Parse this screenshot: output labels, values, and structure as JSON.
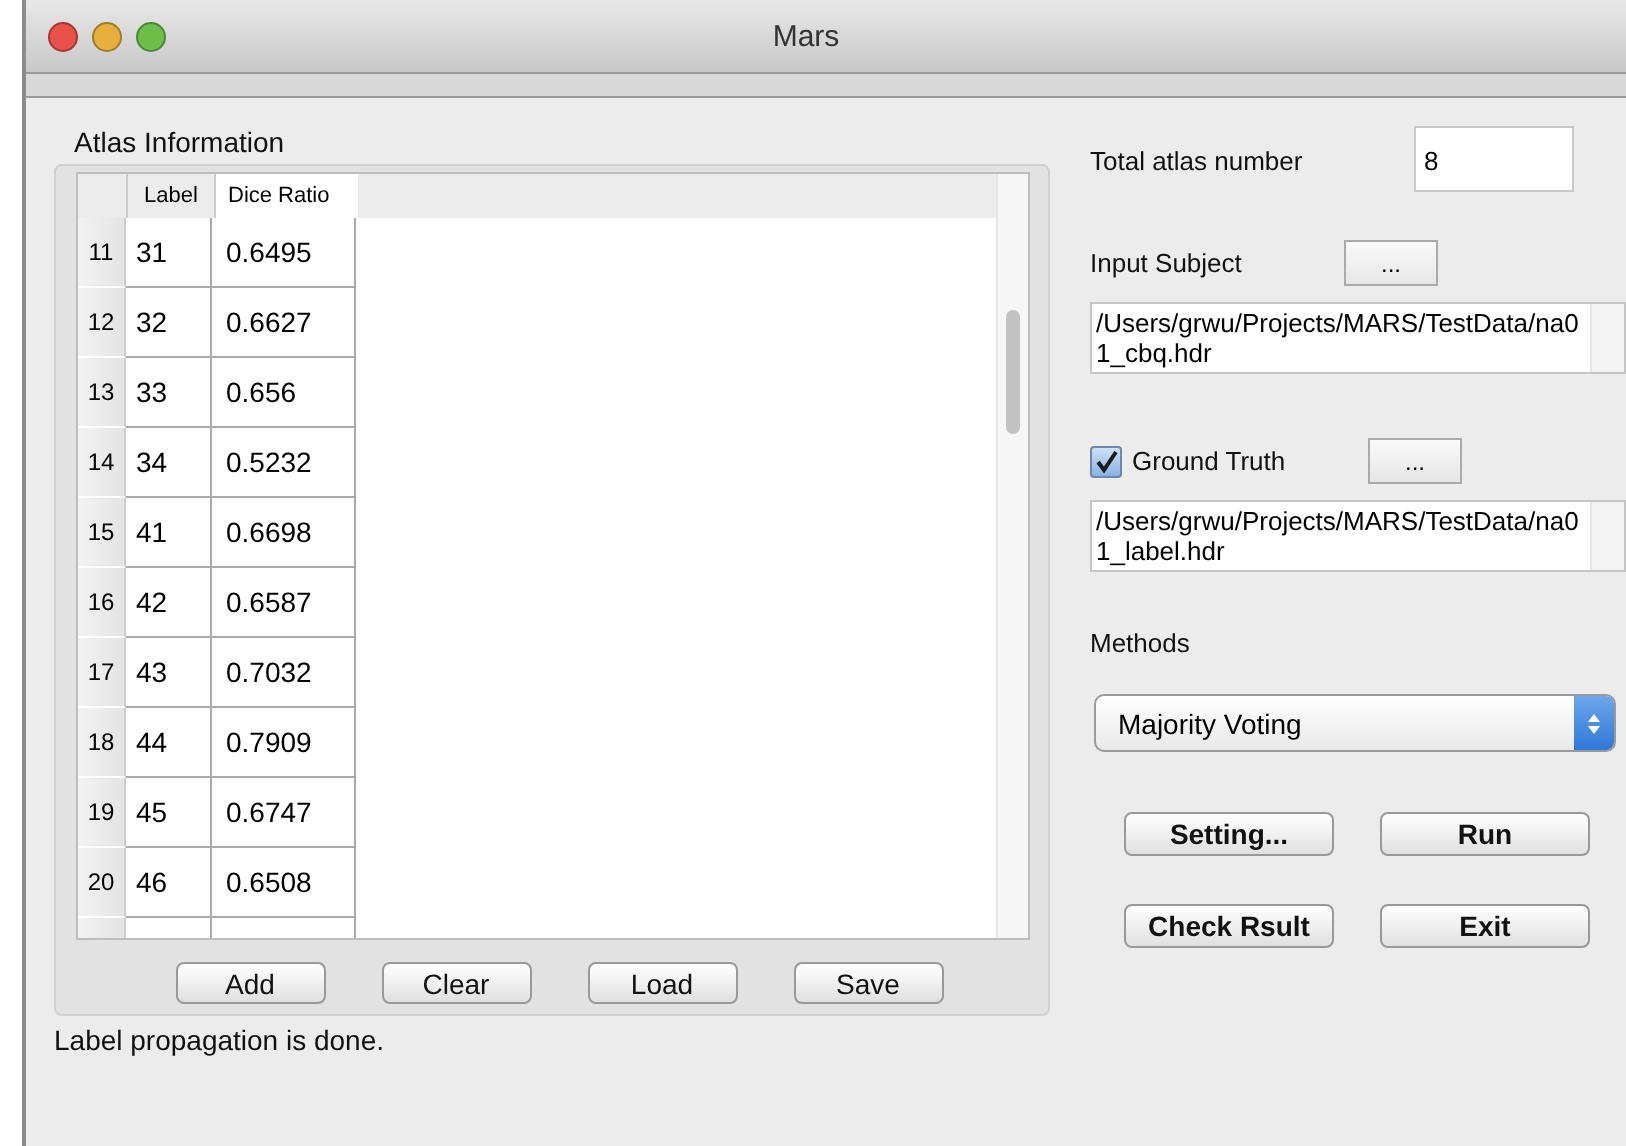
{
  "window": {
    "title": "Mars"
  },
  "atlas_panel": {
    "title": "Atlas Information",
    "table": {
      "columns": [
        "Label",
        "Dice Ratio"
      ],
      "rows": [
        {
          "index": "11",
          "label": "31",
          "dice": "0.6495"
        },
        {
          "index": "12",
          "label": "32",
          "dice": "0.6627"
        },
        {
          "index": "13",
          "label": "33",
          "dice": "0.656"
        },
        {
          "index": "14",
          "label": "34",
          "dice": "0.5232"
        },
        {
          "index": "15",
          "label": "41",
          "dice": "0.6698"
        },
        {
          "index": "16",
          "label": "42",
          "dice": "0.6587"
        },
        {
          "index": "17",
          "label": "43",
          "dice": "0.7032"
        },
        {
          "index": "18",
          "label": "44",
          "dice": "0.7909"
        },
        {
          "index": "19",
          "label": "45",
          "dice": "0.6747"
        },
        {
          "index": "20",
          "label": "46",
          "dice": "0.6508"
        }
      ]
    },
    "buttons": [
      "Add",
      "Clear",
      "Load",
      "Save"
    ]
  },
  "status": "Label propagation is done.",
  "total_atlas": {
    "label": "Total atlas number",
    "value": "8"
  },
  "input_subject": {
    "label": "Input Subject",
    "button": "...",
    "path": "/Users/grwu/Projects/MARS/TestData/na01_cbq.hdr"
  },
  "ground_truth": {
    "label": "Ground Truth",
    "checked": true,
    "button": "...",
    "path": "/Users/grwu/Projects/MARS/TestData/na01_label.hdr"
  },
  "methods": {
    "label": "Methods",
    "value": "Majority Voting"
  },
  "actions": [
    "Setting...",
    "Run",
    "Check Rsult",
    "Exit"
  ]
}
